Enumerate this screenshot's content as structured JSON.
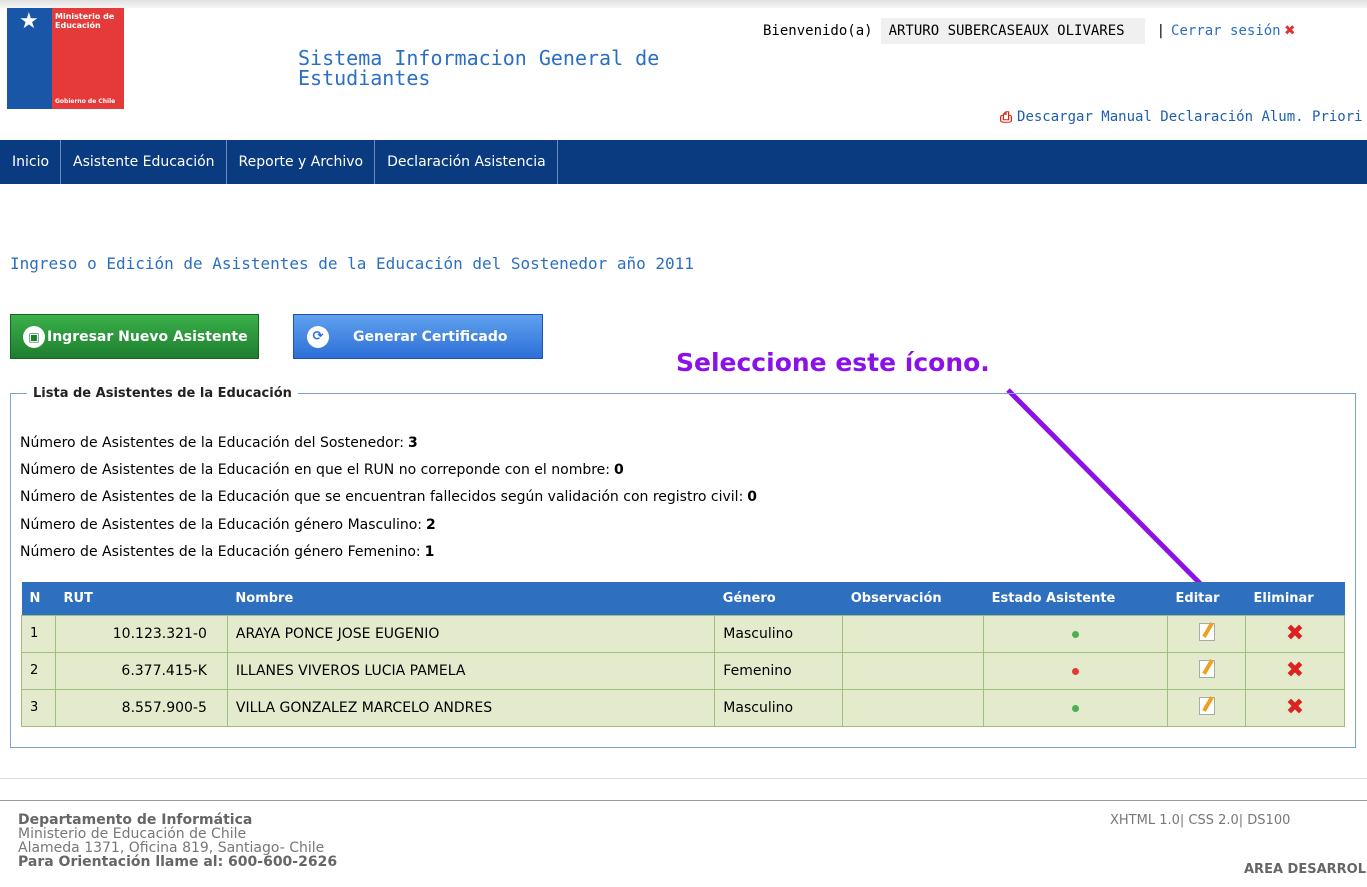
{
  "logo": {
    "ministerio": "Ministerio de\nEducación",
    "gobierno": "Gobierno de Chile"
  },
  "header": {
    "system_title": "Sistema Informacion General de Estudiantes",
    "welcome_label": "Bienvenido(a)",
    "user_name": "ARTURO SUBERCASEAUX OLIVARES",
    "separator": "|",
    "logout_label": "Cerrar sesión",
    "manual_link": "Descargar Manual Declaración Alum. Priori"
  },
  "nav": {
    "items": [
      "Inicio",
      "Asistente Educación",
      "Reporte y Archivo",
      "Declaración Asistencia"
    ]
  },
  "main": {
    "heading": "Ingreso o Edición de Asistentes de la Educación del Sostenedor año 2011",
    "btn_new": "Ingresar Nuevo Asistente",
    "btn_cert": "Generar Certificado",
    "annotation": "Seleccione este ícono.",
    "fieldset_legend": "Lista de Asistentes de la Educación",
    "stats": [
      {
        "label": "Número de Asistentes de la Educación del Sostenedor:",
        "value": "3"
      },
      {
        "label": "Número de Asistentes de la Educación en que el RUN no correponde con el nombre:",
        "value": "0"
      },
      {
        "label": "Número de Asistentes de la Educación que se encuentran fallecidos según validación con registro civil:",
        "value": "0"
      },
      {
        "label": "Número de Asistentes de la Educación género Masculino:",
        "value": "2"
      },
      {
        "label": "Número de Asistentes de la Educación género Femenino:",
        "value": "1"
      }
    ],
    "table": {
      "headers": [
        "N",
        "RUT",
        "Nombre",
        "Género",
        "Observación",
        "Estado Asistente",
        "Editar",
        "Eliminar"
      ],
      "rows": [
        {
          "n": "1",
          "rut": "10.123.321-0",
          "nombre": "ARAYA PONCE JOSE EUGENIO",
          "genero": "Masculino",
          "observacion": "",
          "estado_color": "#4caf50"
        },
        {
          "n": "2",
          "rut": "6.377.415-K",
          "nombre": "ILLANES VIVEROS LUCIA PAMELA",
          "genero": "Femenino",
          "observacion": "",
          "estado_color": "#e53935"
        },
        {
          "n": "3",
          "rut": "8.557.900-5",
          "nombre": "VILLA GONZALEZ MARCELO ANDRES",
          "genero": "Masculino",
          "observacion": "",
          "estado_color": "#4caf50"
        }
      ]
    }
  },
  "footer": {
    "dept": "Departamento de Informática",
    "ministry": "Ministerio de Educación de Chile",
    "address": "Alameda 1371, Oficina 819, Santiago- Chile",
    "phone": "Para Orientación llame al: 600-600-2626",
    "standards": "XHTML 1.0| CSS 2.0| DS100",
    "area": "AREA DESARROLLO"
  },
  "colors": {
    "nav_bg": "#0a3b80",
    "link": "#2b6fc2",
    "annotation": "#8a12e8",
    "table_header": "#2f6fbf",
    "table_row": "#e3ebcc"
  }
}
